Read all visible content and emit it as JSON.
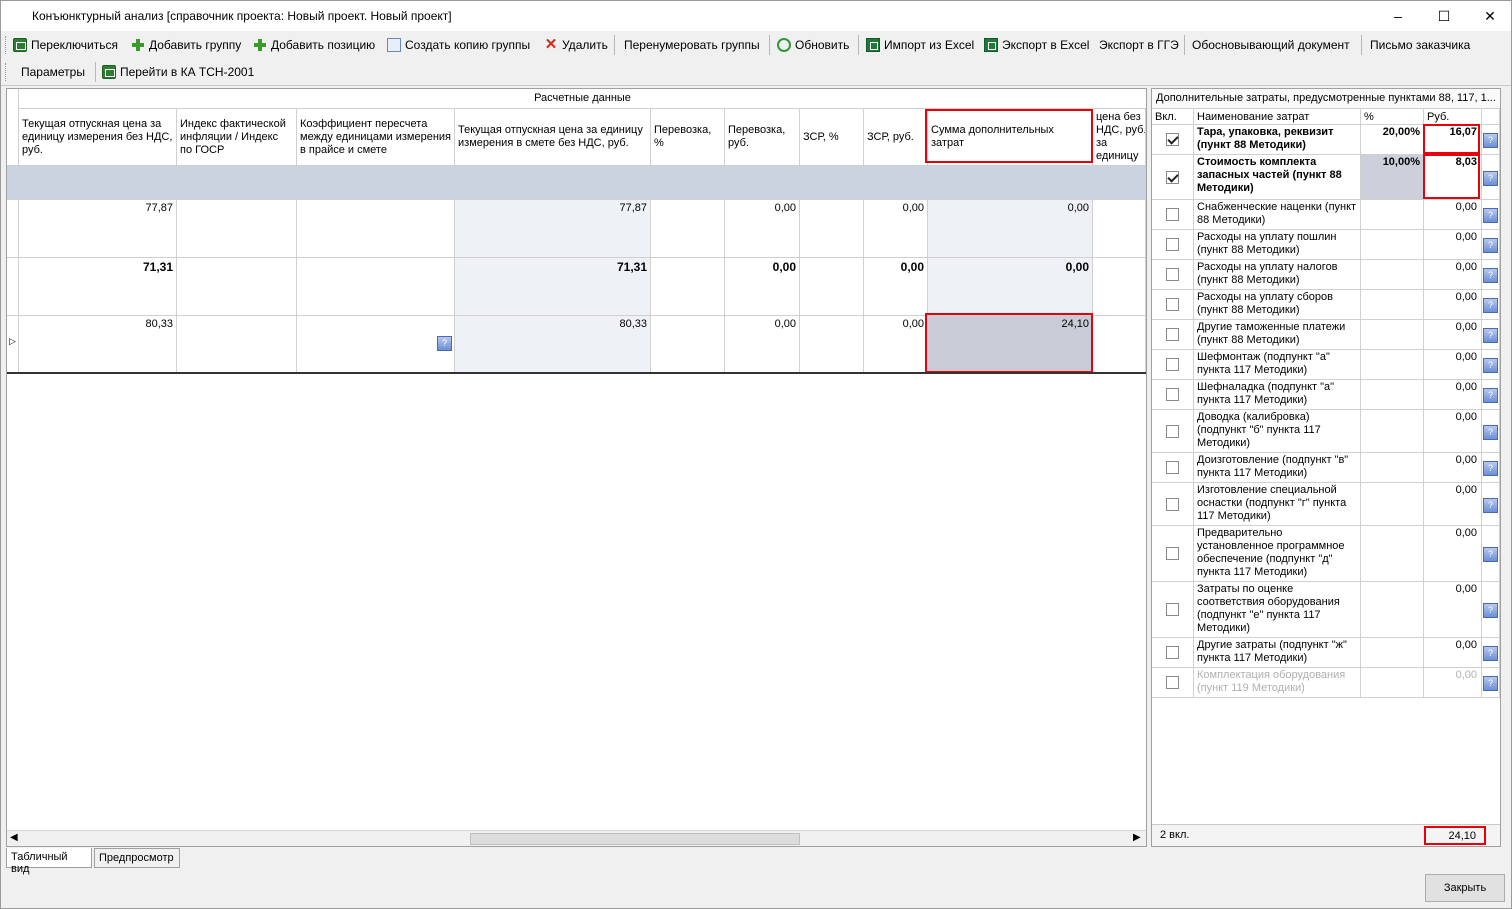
{
  "window": {
    "title": "Конъюнктурный анализ [справочник проекта: Новый проект. Новый проект]"
  },
  "toolbar1": {
    "switch": "Переключиться",
    "add_group": "Добавить группу",
    "add_position": "Добавить позицию",
    "copy_group": "Создать копию группы",
    "delete": "Удалить",
    "renumber": "Перенумеровать группы",
    "refresh": "Обновить",
    "import_excel": "Импорт из Excel",
    "export_excel": "Экспорт в Excel",
    "export_gge": "Экспорт в ГГЭ",
    "justifying_doc": "Обосновывающий документ",
    "customer_letter": "Письмо заказчика"
  },
  "toolbar2": {
    "params": "Параметры",
    "goto_ka": "Перейти в КА ТСН-2001"
  },
  "grid": {
    "group_header": "Расчетные данные",
    "columns": [
      "Текущая отпускная цена за единицу измерения без НДС, руб.",
      "Индекс фактической инфляции /  Индекс по  ГОСР",
      "Коэффициент пересчета между единицами измерения в прайсе и смете",
      "Текущая отпускная цена за единицу измерения в смете без НДС, руб.",
      "Перевозка, %",
      "Перевозка, руб.",
      "ЗСР, %",
      "ЗСР, руб.",
      "Сумма дополнительных затрат",
      "Сметная цена без НДС, руб. за единицу измерения"
    ],
    "rows": [
      {
        "c0": "77,87",
        "c3": "77,87",
        "c5": "0,00",
        "c7": "0,00",
        "c8": "0,00",
        "bold": false
      },
      {
        "c0": "71,31",
        "c3": "71,31",
        "c5": "0,00",
        "c7": "0,00",
        "c8": "0,00",
        "bold": true
      },
      {
        "c0": "80,33",
        "c3": "80,33",
        "c5": "0,00",
        "c7": "0,00",
        "c8": "24,10",
        "bold": false
      }
    ]
  },
  "right_panel": {
    "title": "Дополнительные затраты, предусмотренные пунктами 88, 117, 1...",
    "headers": {
      "on": "Вкл.",
      "name": "Наименование затрат",
      "pct": "%",
      "rub": "Руб."
    },
    "items": [
      {
        "name": "Тара, упаковка, реквизит (пункт 88 Методики)",
        "pct": "20,00%",
        "rub": "16,07",
        "checked": true,
        "bold": true
      },
      {
        "name": "Стоимость комплекта запасных частей (пункт 88 Методики)",
        "pct": "10,00%",
        "rub": "8,03",
        "checked": true,
        "bold": true
      },
      {
        "name": "Снабженческие наценки (пункт 88 Методики)",
        "pct": "",
        "rub": "0,00",
        "checked": false
      },
      {
        "name": "Расходы на уплату пошлин (пункт 88 Методики)",
        "pct": "",
        "rub": "0,00",
        "checked": false
      },
      {
        "name": "Расходы на уплату налогов (пункт 88 Методики)",
        "pct": "",
        "rub": "0,00",
        "checked": false
      },
      {
        "name": "Расходы на уплату сборов (пункт 88 Методики)",
        "pct": "",
        "rub": "0,00",
        "checked": false
      },
      {
        "name": "Другие таможенные платежи (пункт 88 Методики)",
        "pct": "",
        "rub": "0,00",
        "checked": false
      },
      {
        "name": "Шефмонтаж (подпункт \"а\" пункта 117 Методики)",
        "pct": "",
        "rub": "0,00",
        "checked": false
      },
      {
        "name": "Шефналадка (подпункт \"а\" пункта 117 Методики)",
        "pct": "",
        "rub": "0,00",
        "checked": false
      },
      {
        "name": "Доводка (калибровка) (подпункт \"б\" пункта 117 Методики)",
        "pct": "",
        "rub": "0,00",
        "checked": false
      },
      {
        "name": "Доизготовление (подпункт \"в\" пункта 117 Методики)",
        "pct": "",
        "rub": "0,00",
        "checked": false
      },
      {
        "name": "Изготовление специальной оснастки (подпункт \"г\" пункта 117 Методики)",
        "pct": "",
        "rub": "0,00",
        "checked": false
      },
      {
        "name": "Предварительно установленное программное обеспечение (подпункт \"д\" пункта 117 Методики)",
        "pct": "",
        "rub": "0,00",
        "checked": false
      },
      {
        "name": "Затраты по оценке соответствия оборудования (подпункт \"е\" пункта 117 Методики)",
        "pct": "",
        "rub": "0,00",
        "checked": false
      },
      {
        "name": "Другие затраты (подпункт \"ж\" пункта 117 Методики)",
        "pct": "",
        "rub": "0,00",
        "checked": false
      },
      {
        "name": "Комплектация оборудования (пункт 119 Методики)",
        "pct": "",
        "rub": "0,00",
        "checked": false,
        "disabled": true
      }
    ],
    "footer": {
      "count": "2 вкл.",
      "total": "24,10"
    }
  },
  "tabs": {
    "table_view": "Табличный вид",
    "preview": "Предпросмотр"
  },
  "close_button": "Закрыть"
}
